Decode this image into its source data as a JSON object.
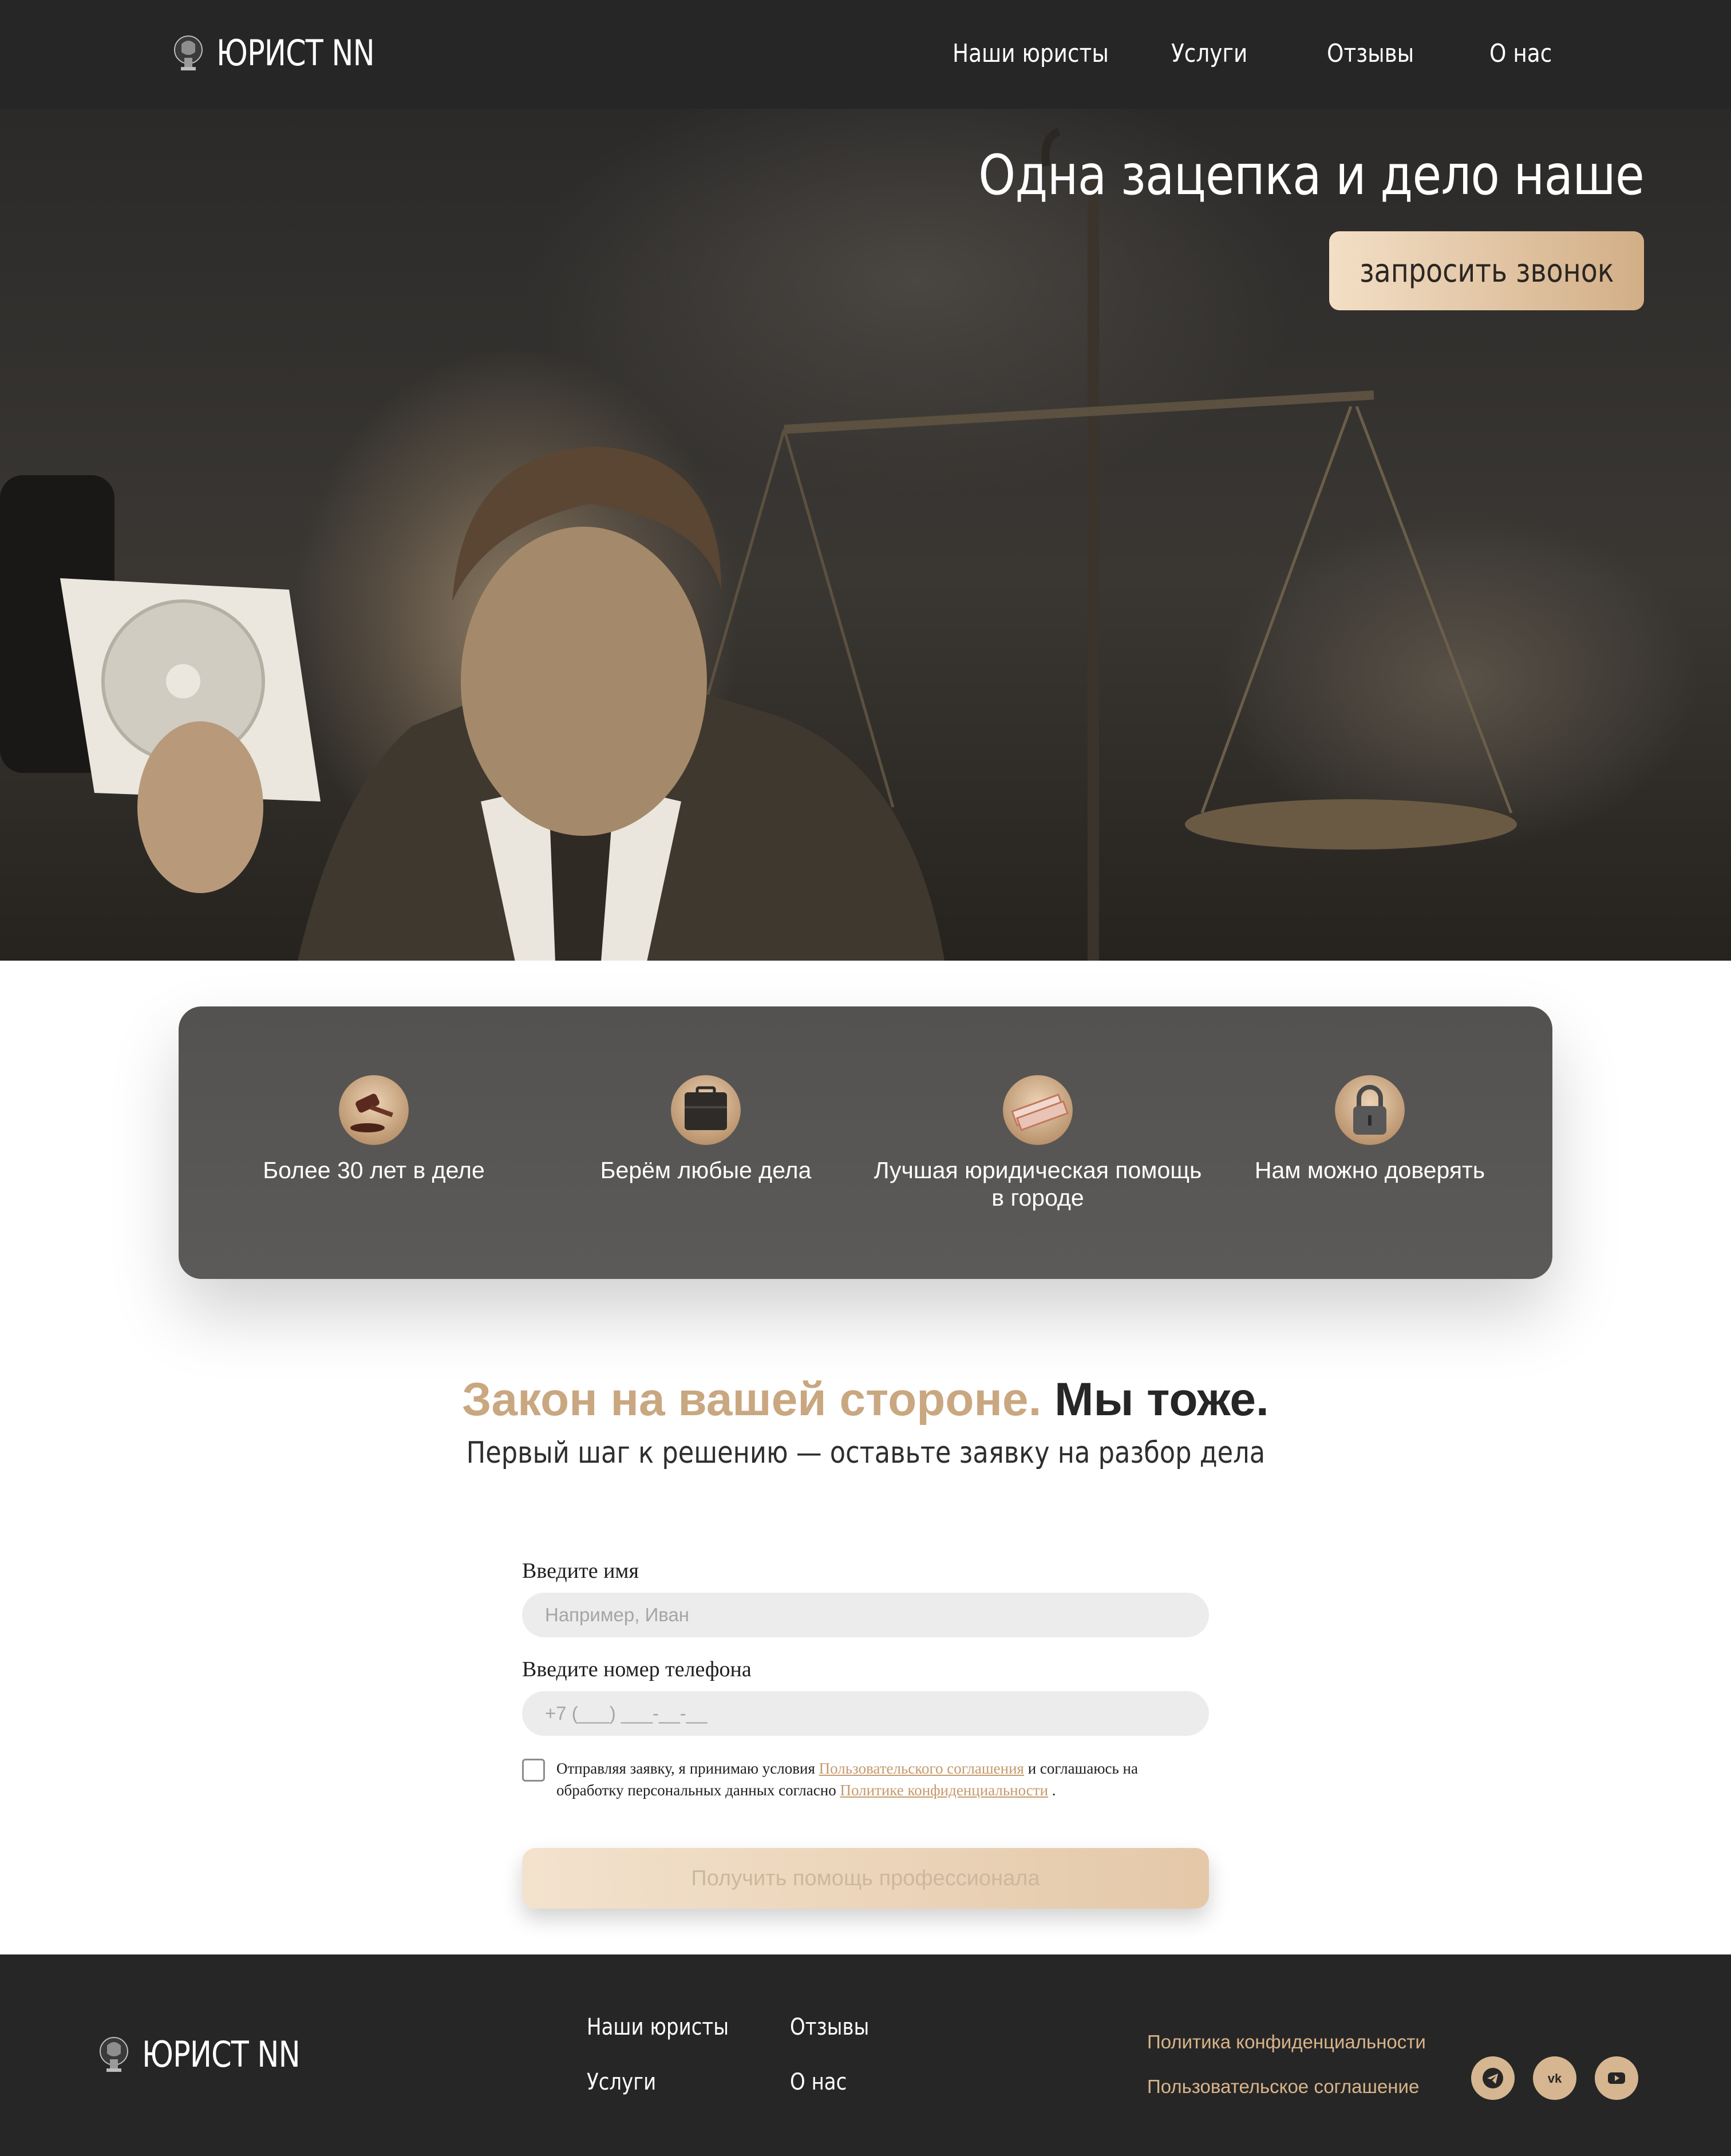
{
  "header": {
    "logo_text": "ЮРИСТ NN",
    "nav": [
      "Наши юристы",
      "Услуги",
      "Отзывы",
      "О нас"
    ]
  },
  "hero": {
    "title": "Одна зацепка и дело наше",
    "cta_label": "запросить звонок"
  },
  "features": [
    {
      "icon": "gavel-icon",
      "label": "Более 30 лет в деле"
    },
    {
      "icon": "briefcase-icon",
      "label": "Берём любые дела"
    },
    {
      "icon": "money-icon",
      "label": "Лучшая юридическая помощь в городе"
    },
    {
      "icon": "padlock-icon",
      "label": "Нам можно доверять"
    }
  ],
  "headline": {
    "accent": "Закон на вашей стороне.",
    "rest": "Мы тоже.",
    "subtitle": "Первый шаг к решению — оставьте заявку на разбор дела"
  },
  "form": {
    "name_label": "Введите имя",
    "name_placeholder": "Например, Иван",
    "phone_label": "Введите номер телефона",
    "phone_placeholder": "+7 (___) ___-__-__",
    "consent_before": "Отправляя заявку, я принимаю условия",
    "consent_link1": "Пользовательского соглашения",
    "consent_middle": "и соглашаюсь на обработку персональных данных согласно",
    "consent_link2": "Политике конфиденциальности",
    "consent_after": ".",
    "submit_label": "Получить помощь профессионала"
  },
  "footer": {
    "logo_text": "ЮРИСТ NN",
    "nav": [
      "Наши юристы",
      "Отзывы",
      "Услуги",
      "О нас"
    ],
    "legal": [
      "Политика конфиденциальности",
      "Пользовательское соглашение"
    ],
    "social": [
      "telegram-icon",
      "vk-icon",
      "youtube-icon"
    ]
  },
  "colors": {
    "dark": "#262626",
    "accent": "#c9a780",
    "panel": "#575553"
  }
}
